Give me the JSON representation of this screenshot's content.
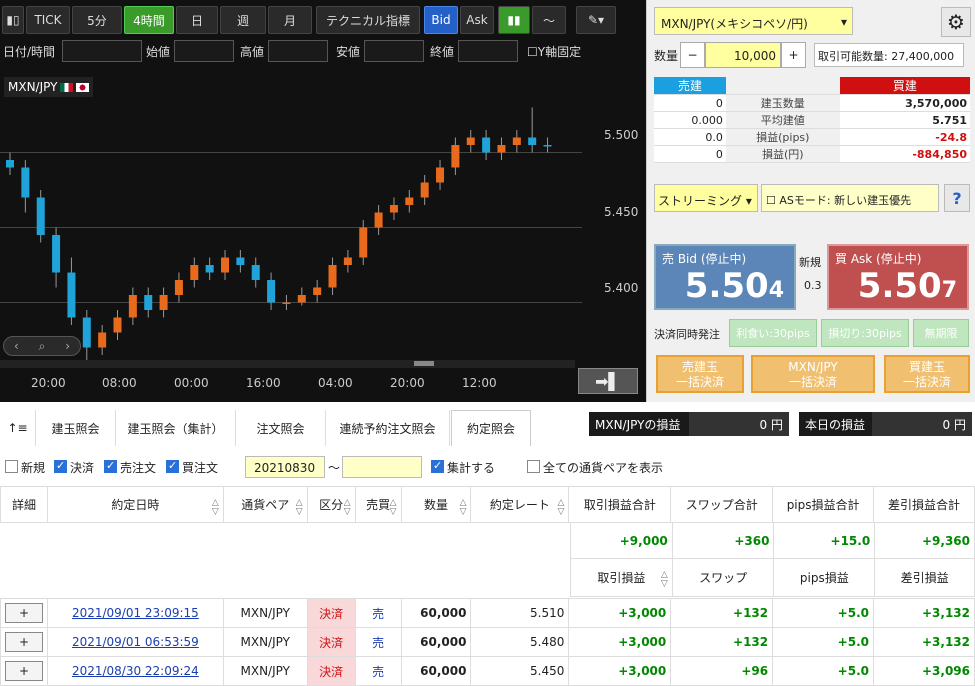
{
  "toolbar": {
    "tick": "TICK",
    "m5": "5分",
    "h4": "4時間",
    "day": "日",
    "week": "週",
    "month": "月",
    "tech": "テクニカル指標",
    "bid": "Bid",
    "ask": "Ask"
  },
  "filters": {
    "date": "日付/時間",
    "open": "始値",
    "high": "高値",
    "low": "安値",
    "close": "終値",
    "yfix": "Y軸固定"
  },
  "chart": {
    "pair": "MXN/JPY",
    "ylabels": [
      "5.500",
      "5.450",
      "5.400"
    ],
    "xlabels": [
      "20:00",
      "08:00",
      "00:00",
      "16:00",
      "04:00",
      "20:00",
      "12:00"
    ]
  },
  "chart_data": {
    "type": "candlestick",
    "yrange": [
      5.355,
      5.555
    ],
    "ticks": [
      5.5,
      5.45,
      5.4
    ],
    "candles": [
      [
        5.495,
        5.49,
        5.5,
        5.485
      ],
      [
        5.49,
        5.47,
        5.495,
        5.46
      ],
      [
        5.47,
        5.445,
        5.475,
        5.44
      ],
      [
        5.445,
        5.42,
        5.45,
        5.41
      ],
      [
        5.42,
        5.39,
        5.43,
        5.385
      ],
      [
        5.39,
        5.37,
        5.395,
        5.36
      ],
      [
        5.37,
        5.38,
        5.385,
        5.365
      ],
      [
        5.38,
        5.39,
        5.395,
        5.375
      ],
      [
        5.39,
        5.405,
        5.41,
        5.385
      ],
      [
        5.405,
        5.395,
        5.41,
        5.39
      ],
      [
        5.395,
        5.405,
        5.41,
        5.39
      ],
      [
        5.405,
        5.415,
        5.42,
        5.4
      ],
      [
        5.415,
        5.425,
        5.43,
        5.41
      ],
      [
        5.425,
        5.42,
        5.43,
        5.415
      ],
      [
        5.42,
        5.43,
        5.435,
        5.415
      ],
      [
        5.43,
        5.425,
        5.435,
        5.42
      ],
      [
        5.425,
        5.415,
        5.43,
        5.41
      ],
      [
        5.415,
        5.4,
        5.42,
        5.395
      ],
      [
        5.4,
        5.4,
        5.405,
        5.395
      ],
      [
        5.4,
        5.405,
        5.41,
        5.398
      ],
      [
        5.405,
        5.41,
        5.415,
        5.4
      ],
      [
        5.41,
        5.425,
        5.43,
        5.405
      ],
      [
        5.425,
        5.43,
        5.435,
        5.42
      ],
      [
        5.43,
        5.45,
        5.455,
        5.425
      ],
      [
        5.45,
        5.46,
        5.465,
        5.445
      ],
      [
        5.46,
        5.465,
        5.47,
        5.455
      ],
      [
        5.465,
        5.47,
        5.475,
        5.46
      ],
      [
        5.47,
        5.48,
        5.485,
        5.465
      ],
      [
        5.48,
        5.49,
        5.495,
        5.475
      ],
      [
        5.49,
        5.505,
        5.51,
        5.485
      ],
      [
        5.505,
        5.51,
        5.515,
        5.5
      ],
      [
        5.51,
        5.5,
        5.515,
        5.495
      ],
      [
        5.5,
        5.505,
        5.51,
        5.495
      ],
      [
        5.505,
        5.51,
        5.515,
        5.5
      ],
      [
        5.51,
        5.505,
        5.53,
        5.5
      ],
      [
        5.505,
        5.504,
        5.51,
        5.5
      ]
    ]
  },
  "order": {
    "pair_select": "MXN/JPY(メキシコペソ/円)",
    "qty_label": "数量",
    "qty": "10,000",
    "avail": "取引可能数量: 27,400,000",
    "pos": {
      "sell_h": "売建",
      "buy_h": "買建",
      "rows": [
        {
          "s": "0",
          "l": "建玉数量",
          "b": "3,570,000"
        },
        {
          "s": "0.000",
          "l": "平均建値",
          "b": "5.751"
        },
        {
          "s": "0.0",
          "l": "損益(pips)",
          "b": "-24.8"
        },
        {
          "s": "0",
          "l": "損益(円)",
          "b": "-884,850"
        }
      ]
    },
    "streaming": "ストリーミング",
    "asmode": "ASモード: 新しい建玉優先",
    "help": "?",
    "sell_title": "売 Bid (停止中)",
    "sell_price_main": "5.50",
    "sell_price_small": "4",
    "buy_title": "買 Ask (停止中)",
    "buy_price_main": "5.50",
    "buy_price_small": "7",
    "shinki": "新規",
    "spread": "0.3",
    "kessai": "決済同時発注",
    "rikaku": "利食い:30pips",
    "songiri": "損切り:30pips",
    "mukigen": "無期限",
    "btn_sell_close": "売建玉\n一括決済",
    "btn_pair_close": "MXN/JPY\n一括決済",
    "btn_buy_close": "買建玉\n一括決済"
  },
  "tabs": [
    "建玉照会",
    "建玉照会（集計）",
    "注文照会",
    "連続予約注文照会",
    "約定照会"
  ],
  "pl": {
    "pair_label": "MXN/JPYの損益",
    "pair_val": "0 円",
    "day_label": "本日の損益",
    "day_val": "0 円"
  },
  "filterrow": {
    "new": "新規",
    "close": "決済",
    "sell": "売注文",
    "buy": "買注文",
    "from": "20210830",
    "tilde": "～",
    "agg": "集計する",
    "all": "全ての通貨ペアを表示"
  },
  "grid": {
    "h": {
      "detail": "詳細",
      "date": "約定日時",
      "pair": "通貨ペア",
      "kubun": "区分",
      "side": "売買",
      "qty": "数量",
      "rate": "約定レート",
      "tpl": "取引損益合計",
      "swap_t": "スワップ合計",
      "pips_t": "pips損益合計",
      "diff_t": "差引損益合計",
      "tpl_v": "+9,000",
      "swap_v": "+360",
      "pips_v": "+15.0",
      "diff_v": "+9,360",
      "tpl2": "取引損益",
      "swap2": "スワップ",
      "pips2": "pips損益",
      "diff2": "差引損益"
    },
    "rows": [
      {
        "btn": "+",
        "date": "2021/09/01 23:09:15",
        "pair": "MXN/JPY",
        "kubun": "決済",
        "side": "売",
        "qty": "60,000",
        "rate": "5.510",
        "tpl": "+3,000",
        "swap": "+132",
        "pips": "+5.0",
        "diff": "+3,132"
      },
      {
        "btn": "+",
        "date": "2021/09/01 06:53:59",
        "pair": "MXN/JPY",
        "kubun": "決済",
        "side": "売",
        "qty": "60,000",
        "rate": "5.480",
        "tpl": "+3,000",
        "swap": "+132",
        "pips": "+5.0",
        "diff": "+3,132"
      },
      {
        "btn": "+",
        "date": "2021/08/30 22:09:24",
        "pair": "MXN/JPY",
        "kubun": "決済",
        "side": "売",
        "qty": "60,000",
        "rate": "5.450",
        "tpl": "+3,000",
        "swap": "+96",
        "pips": "+5.0",
        "diff": "+3,096"
      }
    ]
  }
}
